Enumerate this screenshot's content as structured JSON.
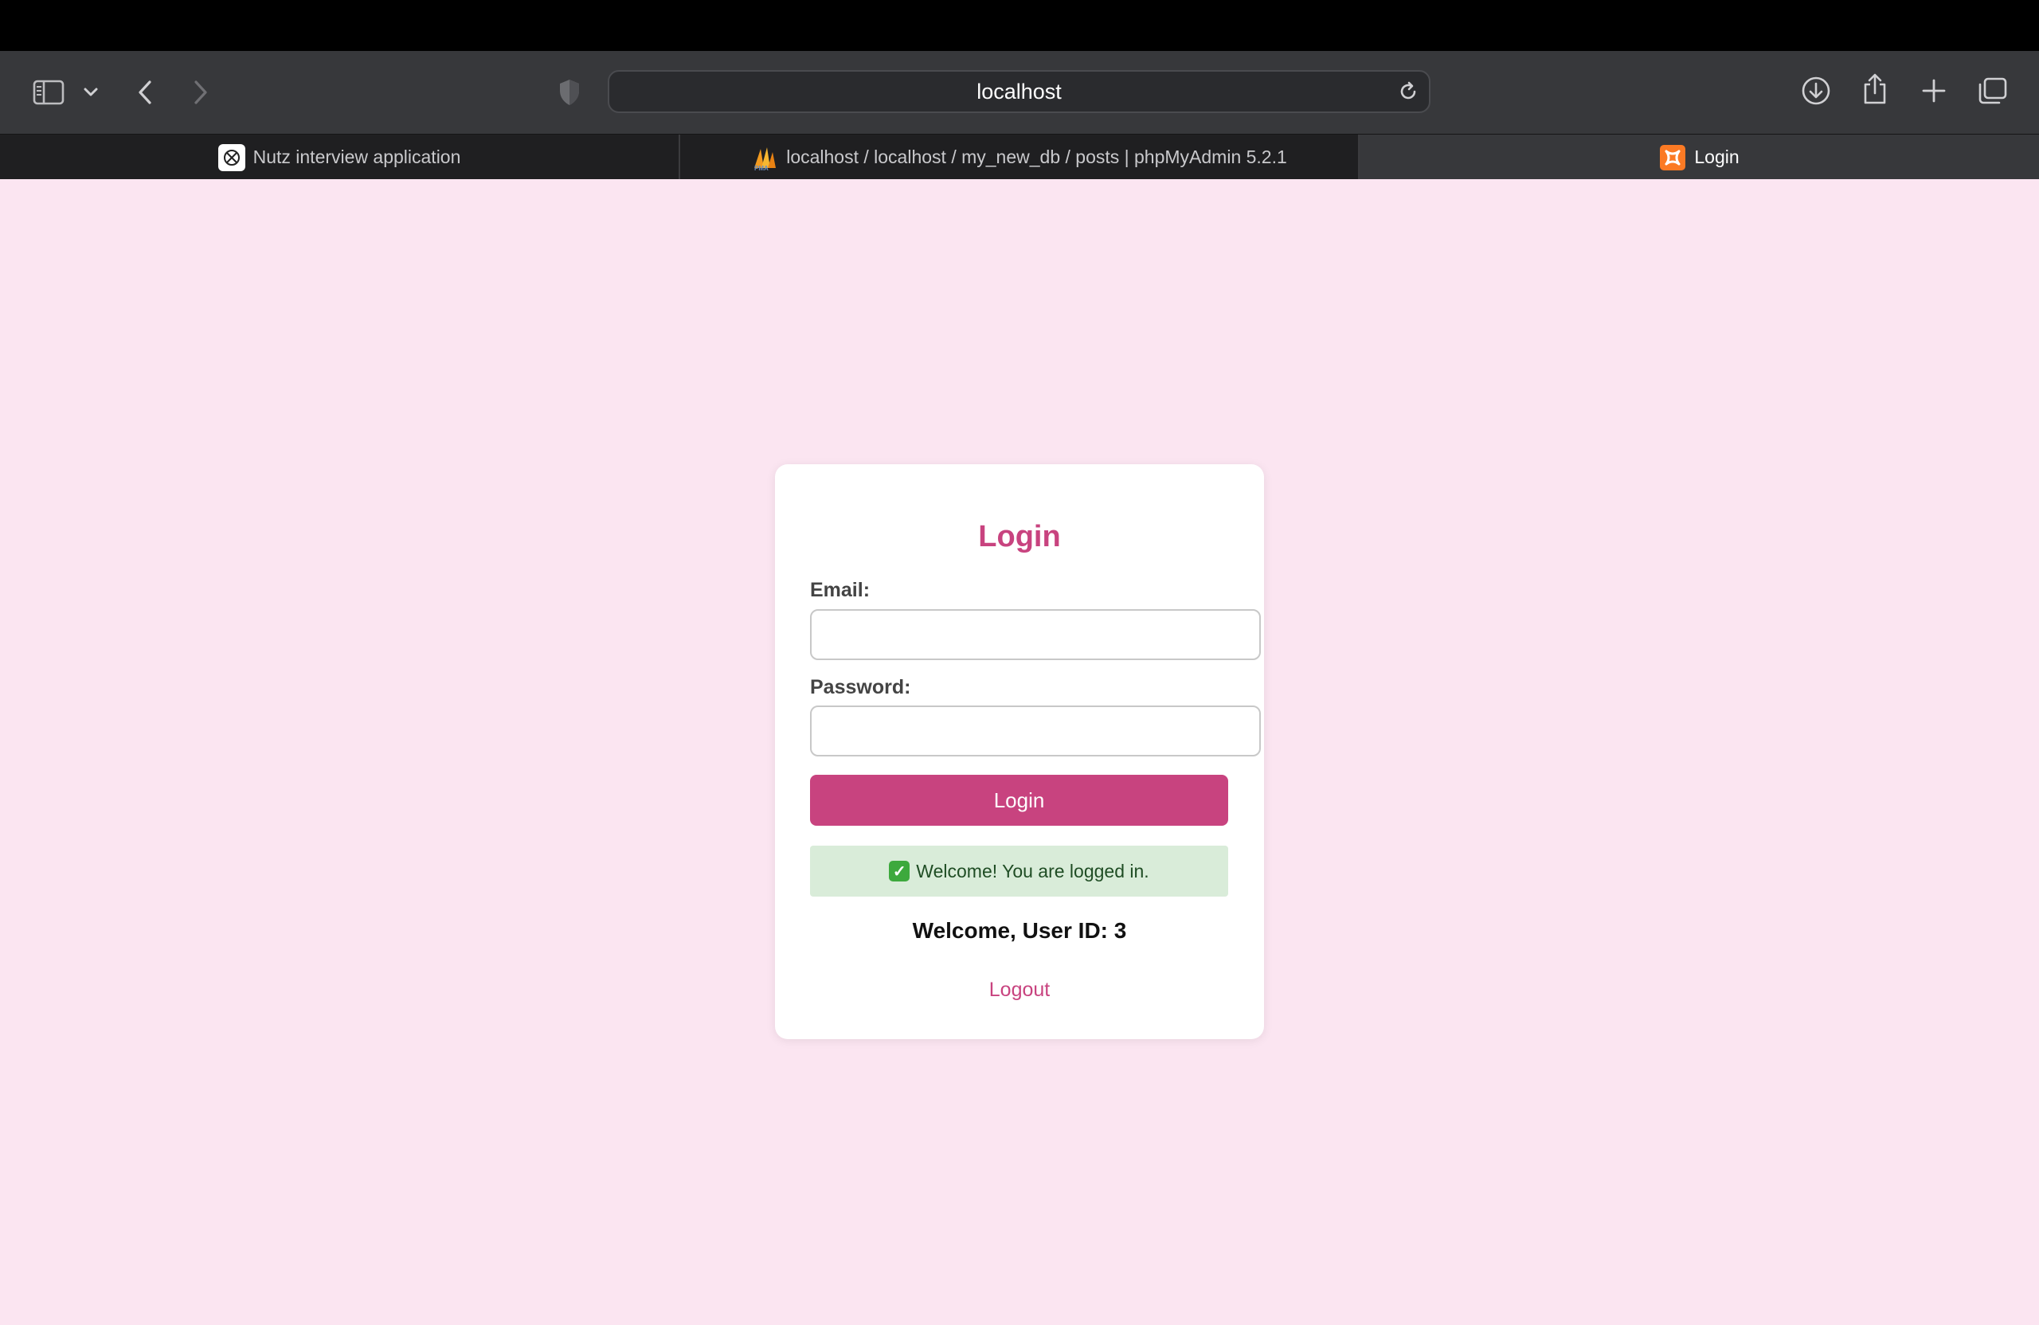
{
  "browser": {
    "url": "localhost",
    "tabs": [
      {
        "label": "Nutz interview application",
        "icon": "chatgpt-icon",
        "active": false
      },
      {
        "label": "localhost / localhost / my_new_db / posts | phpMyAdmin 5.2.1",
        "icon": "phpmyadmin-icon",
        "active": false
      },
      {
        "label": "Login",
        "icon": "xampp-icon",
        "active": true
      }
    ]
  },
  "login": {
    "title": "Login",
    "email_label": "Email:",
    "email_value": "",
    "password_label": "Password:",
    "password_value": "",
    "submit_label": "Login",
    "success_message": "Welcome! You are logged in.",
    "welcome_text": "Welcome, User ID: 3",
    "logout_label": "Logout"
  },
  "colors": {
    "page_background": "#fbe5f1",
    "accent": "#c8437f",
    "success_background": "#d9ecd9"
  }
}
